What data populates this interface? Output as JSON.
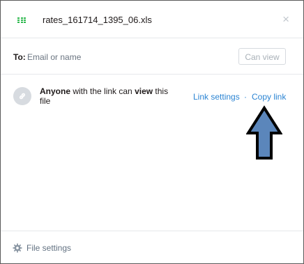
{
  "header": {
    "filename": "rates_161714_1395_06.xls",
    "file_icon": "spreadsheet-icon",
    "close_icon": "close-icon",
    "close_glyph": "×"
  },
  "share": {
    "to_label": "To:",
    "input_placeholder": "Email or name",
    "permission_button": "Can view"
  },
  "link_access": {
    "icon": "link-icon",
    "text_parts": [
      "Anyone",
      " with the link can ",
      "view",
      " this file"
    ],
    "link_settings_label": "Link settings",
    "separator": "·",
    "copy_link_label": "Copy link",
    "annotation": "up-arrow-annotation"
  },
  "footer": {
    "icon": "gear-icon",
    "file_settings_label": "File settings"
  },
  "colors": {
    "accent_link": "#2b84d3",
    "spreadsheet_green": "#2db84d",
    "arrow_fill": "#5b86bb"
  }
}
